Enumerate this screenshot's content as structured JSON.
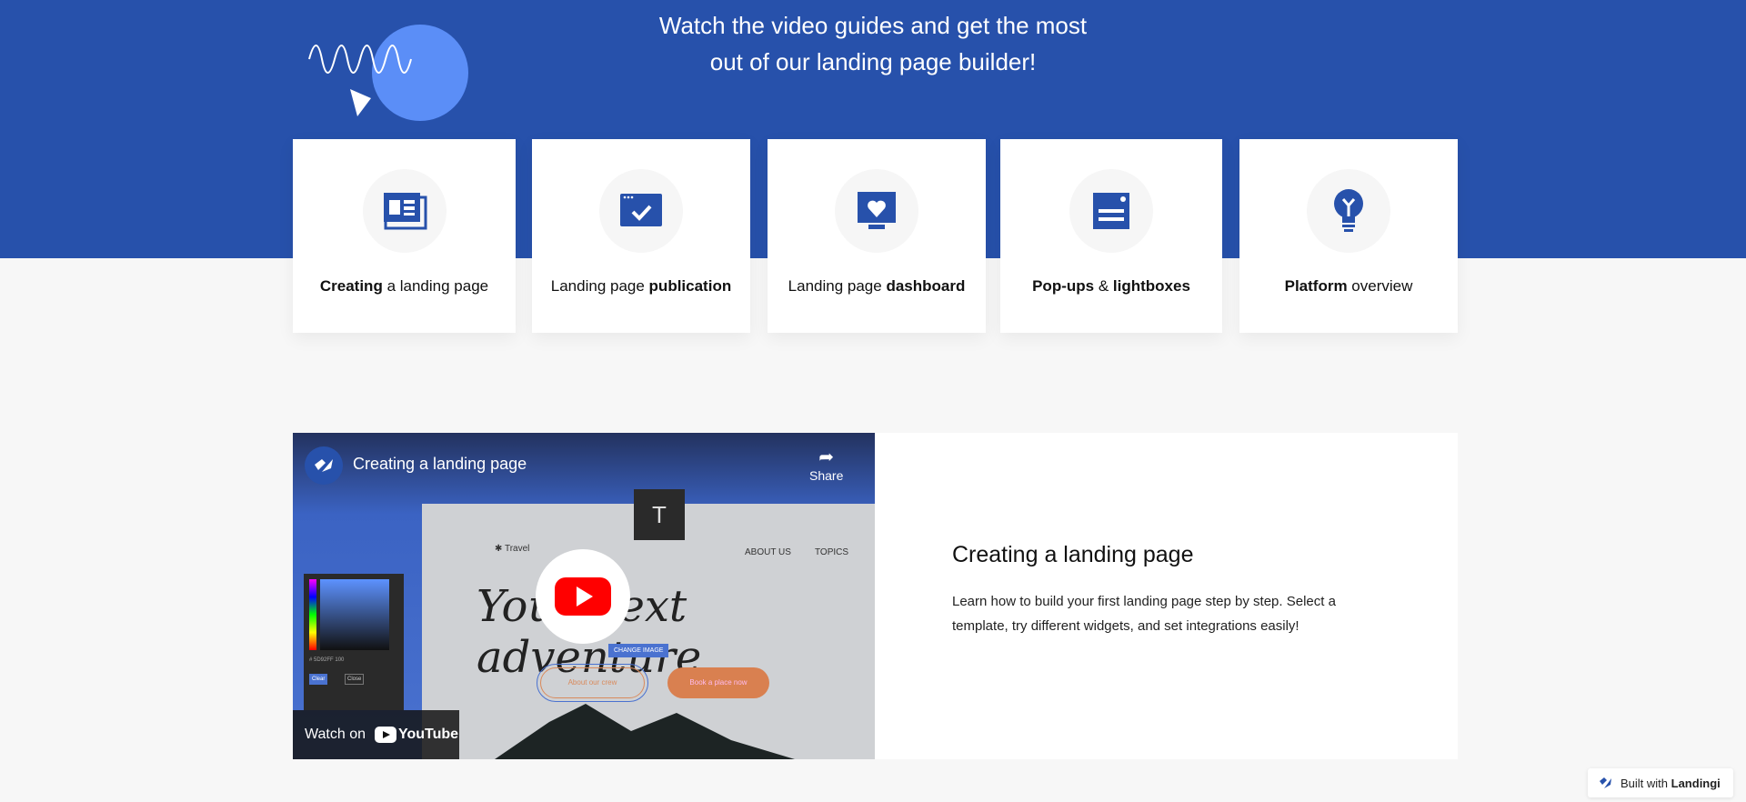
{
  "header": {
    "line1": "Watch the video guides and get the most",
    "line2": "out of our landing page builder!"
  },
  "cards": [
    {
      "bold": "Creating",
      "rest": " a landing page",
      "icon": "browser-windows-icon"
    },
    {
      "pre": "Landing page ",
      "bold": "publication",
      "icon": "browser-check-icon"
    },
    {
      "pre": "Landing page ",
      "bold": "dashboard",
      "icon": "monitor-heart-icon"
    },
    {
      "bold": "Pop-ups",
      "mid": " & ",
      "bold2": "lightboxes",
      "icon": "popup-form-icon"
    },
    {
      "bold": "Platform",
      "rest": " overview",
      "icon": "lightbulb-icon"
    }
  ],
  "video": {
    "title": "Creating a landing page",
    "share": "Share",
    "watch_on": "Watch on",
    "youtube": "YouTube",
    "mock_brand": "Travel",
    "mock_nav": [
      "ABOUT US",
      "TOPICS"
    ],
    "mock_headline": "Your next adventure",
    "btn1": "About our crew",
    "btn2": "Book a place now",
    "change_image": "CHANGE IMAGE",
    "hex": "5D92FF",
    "opacity": "100",
    "clear": "Clear",
    "close": "Close"
  },
  "detail": {
    "title": "Creating a landing page",
    "body": "Learn how to build your first landing page step by step. Select a template, try different widgets, and set integrations easily!"
  },
  "badge": {
    "pre": "Built with ",
    "brand": "Landingi"
  },
  "colors": {
    "brand_blue": "#2751ab",
    "accent_circle": "#5b8ef7",
    "youtube_red": "#ff0000"
  }
}
